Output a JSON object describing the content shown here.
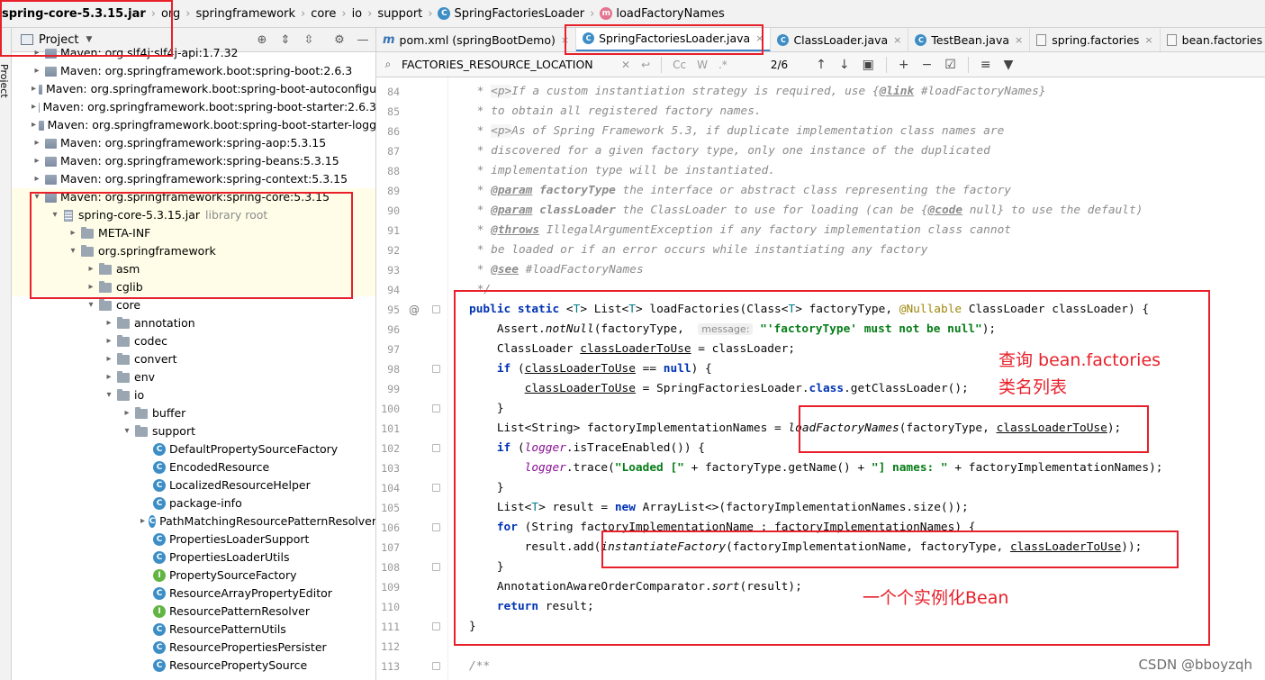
{
  "breadcrumb": [
    "spring-core-5.3.15.jar",
    "org",
    "springframework",
    "core",
    "io",
    "support",
    "SpringFactoriesLoader",
    "loadFactoryNames"
  ],
  "tool_stripe_label": "Project",
  "project_panel": {
    "title": "Project",
    "rows": [
      {
        "indent": 1,
        "arrow": "›",
        "icon": "lib",
        "label": "Maven: org.slf4j:slf4j-api:1.7.32",
        "extra": ""
      },
      {
        "indent": 1,
        "arrow": "›",
        "icon": "lib",
        "label": "Maven: org.springframework.boot:spring-boot:2.6.3",
        "extra": ""
      },
      {
        "indent": 1,
        "arrow": "›",
        "icon": "lib",
        "label": "Maven: org.springframework.boot:spring-boot-autoconfigu",
        "extra": ""
      },
      {
        "indent": 1,
        "arrow": "›",
        "icon": "lib",
        "label": "Maven: org.springframework.boot:spring-boot-starter:2.6.3",
        "extra": ""
      },
      {
        "indent": 1,
        "arrow": "›",
        "icon": "lib",
        "label": "Maven: org.springframework.boot:spring-boot-starter-logg",
        "extra": ""
      },
      {
        "indent": 1,
        "arrow": "›",
        "icon": "lib",
        "label": "Maven: org.springframework:spring-aop:5.3.15",
        "extra": ""
      },
      {
        "indent": 1,
        "arrow": "›",
        "icon": "lib",
        "label": "Maven: org.springframework:spring-beans:5.3.15",
        "extra": ""
      },
      {
        "indent": 1,
        "arrow": "›",
        "icon": "lib",
        "label": "Maven: org.springframework:spring-context:5.3.15",
        "extra": ""
      },
      {
        "indent": 1,
        "arrow": "⌄",
        "icon": "lib",
        "label": "Maven: org.springframework:spring-core:5.3.15",
        "extra": ""
      },
      {
        "indent": 2,
        "arrow": "⌄",
        "icon": "jar",
        "label": "spring-core-5.3.15.jar",
        "extra": "library root"
      },
      {
        "indent": 3,
        "arrow": "›",
        "icon": "folder",
        "label": "META-INF",
        "extra": ""
      },
      {
        "indent": 3,
        "arrow": "⌄",
        "icon": "folder",
        "label": "org.springframework",
        "extra": ""
      },
      {
        "indent": 4,
        "arrow": "›",
        "icon": "folder",
        "label": "asm",
        "extra": ""
      },
      {
        "indent": 4,
        "arrow": "›",
        "icon": "folder",
        "label": "cglib",
        "extra": ""
      },
      {
        "indent": 4,
        "arrow": "⌄",
        "icon": "folder",
        "label": "core",
        "extra": ""
      },
      {
        "indent": 5,
        "arrow": "›",
        "icon": "folder",
        "label": "annotation",
        "extra": ""
      },
      {
        "indent": 5,
        "arrow": "›",
        "icon": "folder",
        "label": "codec",
        "extra": ""
      },
      {
        "indent": 5,
        "arrow": "›",
        "icon": "folder",
        "label": "convert",
        "extra": ""
      },
      {
        "indent": 5,
        "arrow": "›",
        "icon": "folder",
        "label": "env",
        "extra": ""
      },
      {
        "indent": 5,
        "arrow": "⌄",
        "icon": "folder",
        "label": "io",
        "extra": ""
      },
      {
        "indent": 6,
        "arrow": "›",
        "icon": "folder",
        "label": "buffer",
        "extra": ""
      },
      {
        "indent": 6,
        "arrow": "⌄",
        "icon": "folder",
        "label": "support",
        "extra": ""
      },
      {
        "indent": 7,
        "arrow": "",
        "icon": "class",
        "label": "DefaultPropertySourceFactory",
        "extra": ""
      },
      {
        "indent": 7,
        "arrow": "",
        "icon": "class",
        "label": "EncodedResource",
        "extra": ""
      },
      {
        "indent": 7,
        "arrow": "",
        "icon": "class",
        "label": "LocalizedResourceHelper",
        "extra": ""
      },
      {
        "indent": 7,
        "arrow": "",
        "icon": "class",
        "label": "package-info",
        "extra": ""
      },
      {
        "indent": 7,
        "arrow": "›",
        "icon": "class",
        "label": "PathMatchingResourcePatternResolver",
        "extra": ""
      },
      {
        "indent": 7,
        "arrow": "",
        "icon": "class",
        "label": "PropertiesLoaderSupport",
        "extra": ""
      },
      {
        "indent": 7,
        "arrow": "",
        "icon": "class",
        "label": "PropertiesLoaderUtils",
        "extra": ""
      },
      {
        "indent": 7,
        "arrow": "",
        "icon": "interface",
        "label": "PropertySourceFactory",
        "extra": ""
      },
      {
        "indent": 7,
        "arrow": "",
        "icon": "class",
        "label": "ResourceArrayPropertyEditor",
        "extra": ""
      },
      {
        "indent": 7,
        "arrow": "",
        "icon": "interface",
        "label": "ResourcePatternResolver",
        "extra": ""
      },
      {
        "indent": 7,
        "arrow": "",
        "icon": "class",
        "label": "ResourcePatternUtils",
        "extra": ""
      },
      {
        "indent": 7,
        "arrow": "",
        "icon": "class",
        "label": "ResourcePropertiesPersister",
        "extra": ""
      },
      {
        "indent": 7,
        "arrow": "",
        "icon": "class",
        "label": "ResourcePropertySource",
        "extra": ""
      }
    ]
  },
  "tabs": [
    {
      "icon": "m",
      "label": "pom.xml (springBootDemo)",
      "active": false
    },
    {
      "icon": "class",
      "label": "SpringFactoriesLoader.java",
      "active": true
    },
    {
      "icon": "class",
      "label": "ClassLoader.java",
      "active": false
    },
    {
      "icon": "class",
      "label": "TestBean.java",
      "active": false
    },
    {
      "icon": "file",
      "label": "spring.factories",
      "active": false
    },
    {
      "icon": "file",
      "label": "bean.factories",
      "active": false
    }
  ],
  "search": {
    "value": "FACTORIES_RESOURCE_LOCATION",
    "match_count": "2/6",
    "option_cc": "Cc",
    "option_w": "W",
    "option_regex": ".*"
  },
  "code_lines": [
    {
      "n": "84",
      "html": " <span class=\"cmt\">* </span><span class=\"html-tag\">&lt;p&gt;</span><span class=\"cmt\">If a custom instantiation strategy is required, use {</span><span class=\"ctag\">@link</span><span class=\"cmt\"> #loadFactoryNames}</span>"
    },
    {
      "n": "85",
      "html": " <span class=\"cmt\">* to obtain all registered factory names.</span>"
    },
    {
      "n": "86",
      "html": " <span class=\"cmt\">* </span><span class=\"html-tag\">&lt;p&gt;</span><span class=\"cmt\">As of Spring Framework 5.3, if duplicate implementation class names are</span>"
    },
    {
      "n": "87",
      "html": " <span class=\"cmt\">* discovered for a given factory type, only one instance of the duplicated</span>"
    },
    {
      "n": "88",
      "html": " <span class=\"cmt\">* implementation type will be instantiated.</span>"
    },
    {
      "n": "89",
      "html": " <span class=\"cmt\">* </span><span class=\"ctag\">@param</span><span class=\"ckw\"> factoryType</span><span class=\"cmt\"> the interface or abstract class representing the factory</span>"
    },
    {
      "n": "90",
      "html": " <span class=\"cmt\">* </span><span class=\"ctag\">@param</span><span class=\"ckw\"> classLoader</span><span class=\"cmt\"> the ClassLoader to use for loading (can be {</span><span class=\"ctag\">@code</span><span class=\"cmt\"> null} to use the default)</span>"
    },
    {
      "n": "91",
      "html": " <span class=\"cmt\">* </span><span class=\"ctag\">@throws</span><span class=\"cmt\"> IllegalArgumentException if any factory implementation class cannot</span>"
    },
    {
      "n": "92",
      "html": " <span class=\"cmt\">* be loaded or if an error occurs while instantiating any factory</span>"
    },
    {
      "n": "93",
      "html": " <span class=\"cmt\">* </span><span class=\"ctag\">@see</span><span class=\"cmt\"> #loadFactoryNames</span>"
    },
    {
      "n": "94",
      "html": " <span class=\"cmt\">*/</span>"
    },
    {
      "n": "95",
      "html": "<span class=\"kw\">public static</span> &lt;<span style=\"color:#007e8a\">T</span>&gt; List&lt;<span style=\"color:#007e8a\">T</span>&gt; loadFactories(Class&lt;<span style=\"color:#007e8a\">T</span>&gt; factoryType, <span class=\"ann\">@Nullable</span> ClassLoader classLoader) {"
    },
    {
      "n": "96",
      "html": "    Assert.<span class=\"it\">notNull</span>(factoryType,  <span class=\"hint\">message:</span> <span class=\"str\">\"'factoryType' must not be null\"</span>);"
    },
    {
      "n": "97",
      "html": "    ClassLoader <span class=\"ul\">classLoaderToUse</span> = classLoader;"
    },
    {
      "n": "98",
      "html": "    <span class=\"kw\">if</span> (<span class=\"ul\">classLoaderToUse</span> == <span class=\"kw\">null</span>) {"
    },
    {
      "n": "99",
      "html": "        <span class=\"ul\">classLoaderToUse</span> = SpringFactoriesLoader.<span class=\"kw\">class</span>.getClassLoader();"
    },
    {
      "n": "100",
      "html": "    }"
    },
    {
      "n": "101",
      "html": "    List&lt;String&gt; factoryImplementationNames = <span class=\"it\">loadFactoryNames</span>(factoryType, <span class=\"ul\">classLoaderToUse</span>);"
    },
    {
      "n": "102",
      "html": "    <span class=\"kw\">if</span> (<span class=\"fld\">logger</span>.isTraceEnabled()) {"
    },
    {
      "n": "103",
      "html": "        <span class=\"fld\">logger</span>.trace(<span class=\"str\">\"Loaded [\"</span> + factoryType.getName() + <span class=\"str\">\"] names: \"</span> + factoryImplementationNames);"
    },
    {
      "n": "104",
      "html": "    }"
    },
    {
      "n": "105",
      "html": "    List&lt;<span style=\"color:#007e8a\">T</span>&gt; result = <span class=\"kw\">new</span> ArrayList&lt;&gt;(factoryImplementationNames.size());"
    },
    {
      "n": "106",
      "html": "    <span class=\"kw\">for</span> (String factoryImplementationName : factoryImplementationNames) {"
    },
    {
      "n": "107",
      "html": "        result.add(<span class=\"it\">instantiateFactory</span>(factoryImplementationName, factoryType, <span class=\"ul\">classLoaderToUse</span>));"
    },
    {
      "n": "108",
      "html": "    }"
    },
    {
      "n": "109",
      "html": "    AnnotationAwareOrderComparator.<span class=\"it\">sort</span>(result);"
    },
    {
      "n": "110",
      "html": "    <span class=\"kw\">return</span> result;"
    },
    {
      "n": "111",
      "html": "}"
    },
    {
      "n": "112",
      "html": ""
    },
    {
      "n": "113",
      "html": "<span class=\"cmt\">/**</span>"
    }
  ],
  "notes": {
    "query_line1": "查询 bean.factories",
    "query_line2": "类名列表",
    "instantiate": "一个个实例化Bean"
  },
  "watermark": "CSDN @bboyzqh",
  "colors": {
    "annotation_red": "#e8202a",
    "selection_yellow": "#fffde7",
    "tab_underline": "#4083c9",
    "keyword_blue": "#0033b3",
    "string_green": "#067d17"
  }
}
